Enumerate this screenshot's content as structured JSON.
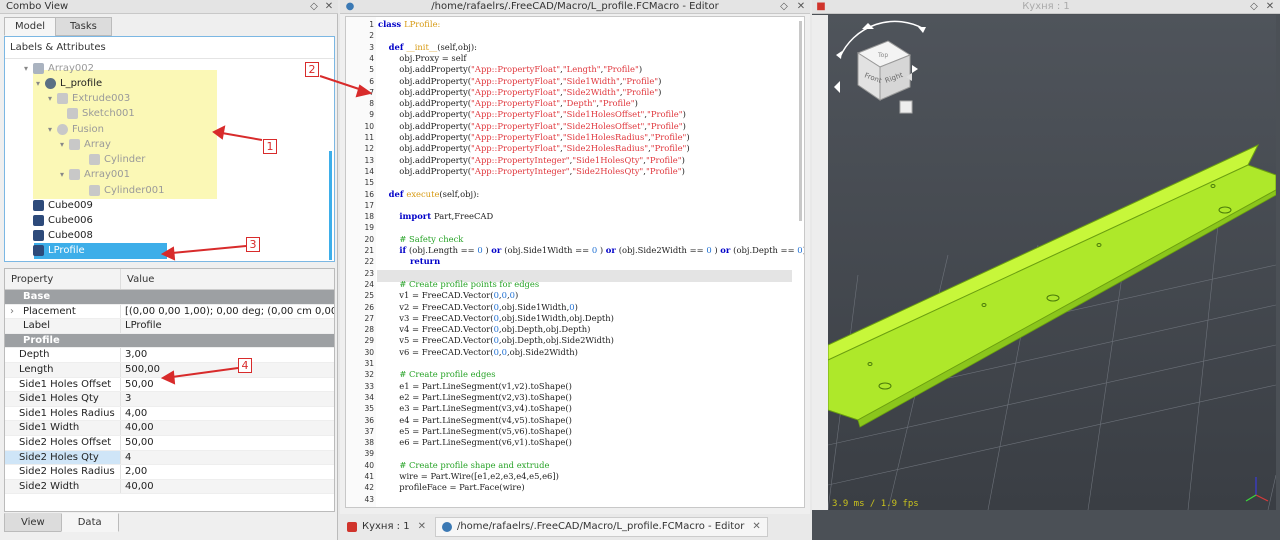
{
  "combo": {
    "title": "Combo View",
    "tabs": [
      "Model",
      "Tasks"
    ],
    "tree_header": "Labels & Attributes",
    "tree": [
      {
        "label": "Array002",
        "dim": true
      },
      {
        "label": "L_profile",
        "dim": false
      },
      {
        "label": "Extrude003",
        "dim": true
      },
      {
        "label": "Sketch001",
        "dim": true
      },
      {
        "label": "Fusion",
        "dim": true
      },
      {
        "label": "Array",
        "dim": true
      },
      {
        "label": "Cylinder",
        "dim": true
      },
      {
        "label": "Array001",
        "dim": true
      },
      {
        "label": "Cylinder001",
        "dim": true
      },
      {
        "label": "Cube009",
        "dim": false
      },
      {
        "label": "Cube006",
        "dim": false
      },
      {
        "label": "Cube008",
        "dim": false
      },
      {
        "label": "LProfile",
        "dim": false
      }
    ],
    "property_header": {
      "name": "Property",
      "value": "Value"
    },
    "base_group": "Base",
    "placement": {
      "name": "Placement",
      "value": "[(0,00 0,00 1,00); 0,00 deg; (0,00 cm  0,00 ..."
    },
    "label_prop": {
      "name": "Label",
      "value": "LProfile"
    },
    "profile_group": "Profile",
    "props": [
      {
        "name": "Depth",
        "value": "3,00"
      },
      {
        "name": "Length",
        "value": "500,00"
      },
      {
        "name": "Side1 Holes Offset",
        "value": "50,00"
      },
      {
        "name": "Side1 Holes Qty",
        "value": "3"
      },
      {
        "name": "Side1 Holes Radius",
        "value": "4,00"
      },
      {
        "name": "Side1 Width",
        "value": "40,00"
      },
      {
        "name": "Side2 Holes Offset",
        "value": "50,00"
      },
      {
        "name": "Side2 Holes Qty",
        "value": "4"
      },
      {
        "name": "Side2 Holes Radius",
        "value": "2,00"
      },
      {
        "name": "Side2 Width",
        "value": "40,00"
      }
    ],
    "bottom_tabs": [
      "View",
      "Data"
    ]
  },
  "editor": {
    "title": "/home/rafaelrs/.FreeCAD/Macro/L_profile.FCMacro - Editor",
    "lines": [
      {
        "n": "1",
        "parts": [
          [
            "kw",
            "class "
          ],
          [
            "cls",
            "LProfile:"
          ]
        ]
      },
      {
        "n": "2",
        "parts": []
      },
      {
        "n": "3",
        "parts": [
          [
            "",
            "    "
          ],
          [
            "kw",
            "def "
          ],
          [
            "cls",
            "__init__"
          ],
          [
            "",
            "(self,obj):"
          ]
        ]
      },
      {
        "n": "4",
        "parts": [
          [
            "",
            "        obj.Proxy = self"
          ]
        ]
      },
      {
        "n": "5",
        "parts": [
          [
            "",
            "        obj.addProperty("
          ],
          [
            "str",
            "\"App::PropertyFloat\""
          ],
          [
            "",
            ","
          ],
          [
            "str",
            "\"Length\""
          ],
          [
            "",
            ","
          ],
          [
            "str",
            "\"Profile\""
          ],
          [
            "",
            ")"
          ]
        ]
      },
      {
        "n": "6",
        "parts": [
          [
            "",
            "        obj.addProperty("
          ],
          [
            "str",
            "\"App::PropertyFloat\""
          ],
          [
            "",
            ","
          ],
          [
            "str",
            "\"Side1Width\""
          ],
          [
            "",
            ","
          ],
          [
            "str",
            "\"Profile\""
          ],
          [
            "",
            ")"
          ]
        ]
      },
      {
        "n": "7",
        "parts": [
          [
            "",
            "        obj.addProperty("
          ],
          [
            "str",
            "\"App::PropertyFloat\""
          ],
          [
            "",
            ","
          ],
          [
            "str",
            "\"Side2Width\""
          ],
          [
            "",
            ","
          ],
          [
            "str",
            "\"Profile\""
          ],
          [
            "",
            ")"
          ]
        ]
      },
      {
        "n": "8",
        "parts": [
          [
            "",
            "        obj.addProperty("
          ],
          [
            "str",
            "\"App::PropertyFloat\""
          ],
          [
            "",
            ","
          ],
          [
            "str",
            "\"Depth\""
          ],
          [
            "",
            ","
          ],
          [
            "str",
            "\"Profile\""
          ],
          [
            "",
            ")"
          ]
        ]
      },
      {
        "n": "9",
        "parts": [
          [
            "",
            "        obj.addProperty("
          ],
          [
            "str",
            "\"App::PropertyFloat\""
          ],
          [
            "",
            ","
          ],
          [
            "str",
            "\"Side1HolesOffset\""
          ],
          [
            "",
            ","
          ],
          [
            "str",
            "\"Profile\""
          ],
          [
            "",
            ")"
          ]
        ]
      },
      {
        "n": "10",
        "parts": [
          [
            "",
            "        obj.addProperty("
          ],
          [
            "str",
            "\"App::PropertyFloat\""
          ],
          [
            "",
            ","
          ],
          [
            "str",
            "\"Side2HolesOffset\""
          ],
          [
            "",
            ","
          ],
          [
            "str",
            "\"Profile\""
          ],
          [
            "",
            ")"
          ]
        ]
      },
      {
        "n": "11",
        "parts": [
          [
            "",
            "        obj.addProperty("
          ],
          [
            "str",
            "\"App::PropertyFloat\""
          ],
          [
            "",
            ","
          ],
          [
            "str",
            "\"Side1HolesRadius\""
          ],
          [
            "",
            ","
          ],
          [
            "str",
            "\"Profile\""
          ],
          [
            "",
            ")"
          ]
        ]
      },
      {
        "n": "12",
        "parts": [
          [
            "",
            "        obj.addProperty("
          ],
          [
            "str",
            "\"App::PropertyFloat\""
          ],
          [
            "",
            ","
          ],
          [
            "str",
            "\"Side2HolesRadius\""
          ],
          [
            "",
            ","
          ],
          [
            "str",
            "\"Profile\""
          ],
          [
            "",
            ")"
          ]
        ]
      },
      {
        "n": "13",
        "parts": [
          [
            "",
            "        obj.addProperty("
          ],
          [
            "str",
            "\"App::PropertyInteger\""
          ],
          [
            "",
            ","
          ],
          [
            "str",
            "\"Side1HolesQty\""
          ],
          [
            "",
            ","
          ],
          [
            "str",
            "\"Profile\""
          ],
          [
            "",
            ")"
          ]
        ]
      },
      {
        "n": "14",
        "parts": [
          [
            "",
            "        obj.addProperty("
          ],
          [
            "str",
            "\"App::PropertyInteger\""
          ],
          [
            "",
            ","
          ],
          [
            "str",
            "\"Side2HolesQty\""
          ],
          [
            "",
            ","
          ],
          [
            "str",
            "\"Profile\""
          ],
          [
            "",
            ")"
          ]
        ]
      },
      {
        "n": "15",
        "parts": []
      },
      {
        "n": "16",
        "parts": [
          [
            "",
            "    "
          ],
          [
            "kw",
            "def "
          ],
          [
            "cls",
            "execute"
          ],
          [
            "",
            "(self,obj):"
          ]
        ]
      },
      {
        "n": "17",
        "parts": []
      },
      {
        "n": "18",
        "parts": [
          [
            "",
            "        "
          ],
          [
            "kw",
            "import "
          ],
          [
            "",
            "Part,FreeCAD"
          ]
        ]
      },
      {
        "n": "19",
        "parts": []
      },
      {
        "n": "20",
        "parts": [
          [
            "",
            "        "
          ],
          [
            "cmt",
            "# Safety check"
          ]
        ]
      },
      {
        "n": "21",
        "parts": [
          [
            "",
            "        "
          ],
          [
            "kw",
            "if "
          ],
          [
            "",
            "(obj.Length == "
          ],
          [
            "num",
            "0"
          ],
          [
            "",
            " ) "
          ],
          [
            "kw",
            "or "
          ],
          [
            "",
            "(obj.Side1Width == "
          ],
          [
            "num",
            "0"
          ],
          [
            "",
            " ) "
          ],
          [
            "kw",
            "or "
          ],
          [
            "",
            "(obj.Side2Width == "
          ],
          [
            "num",
            "0"
          ],
          [
            "",
            " ) "
          ],
          [
            "kw",
            "or "
          ],
          [
            "",
            "(obj.Depth == "
          ],
          [
            "num",
            "0"
          ],
          [
            "",
            ")"
          ]
        ]
      },
      {
        "n": "22",
        "parts": [
          [
            "",
            "            "
          ],
          [
            "kw",
            "return"
          ]
        ]
      },
      {
        "n": "23",
        "parts": []
      },
      {
        "n": "24",
        "parts": [
          [
            "",
            "        "
          ],
          [
            "cmt",
            "# Create profile points for edges"
          ]
        ]
      },
      {
        "n": "25",
        "parts": [
          [
            "",
            "        v1 = FreeCAD.Vector("
          ],
          [
            "num",
            "0"
          ],
          [
            "",
            ","
          ],
          [
            "num",
            "0"
          ],
          [
            "",
            ","
          ],
          [
            "num",
            "0"
          ],
          [
            "",
            ")"
          ]
        ]
      },
      {
        "n": "26",
        "parts": [
          [
            "",
            "        v2 = FreeCAD.Vector("
          ],
          [
            "num",
            "0"
          ],
          [
            "",
            ",obj.Side1Width,"
          ],
          [
            "num",
            "0"
          ],
          [
            "",
            ")"
          ]
        ]
      },
      {
        "n": "27",
        "parts": [
          [
            "",
            "        v3 = FreeCAD.Vector("
          ],
          [
            "num",
            "0"
          ],
          [
            "",
            ",obj.Side1Width,obj.Depth)"
          ]
        ]
      },
      {
        "n": "28",
        "parts": [
          [
            "",
            "        v4 = FreeCAD.Vector("
          ],
          [
            "num",
            "0"
          ],
          [
            "",
            ",obj.Depth,obj.Depth)"
          ]
        ]
      },
      {
        "n": "29",
        "parts": [
          [
            "",
            "        v5 = FreeCAD.Vector("
          ],
          [
            "num",
            "0"
          ],
          [
            "",
            ",obj.Depth,obj.Side2Width)"
          ]
        ]
      },
      {
        "n": "30",
        "parts": [
          [
            "",
            "        v6 = FreeCAD.Vector("
          ],
          [
            "num",
            "0"
          ],
          [
            "",
            ","
          ],
          [
            "num",
            "0"
          ],
          [
            "",
            ",obj.Side2Width)"
          ]
        ]
      },
      {
        "n": "31",
        "parts": []
      },
      {
        "n": "32",
        "parts": [
          [
            "",
            "        "
          ],
          [
            "cmt",
            "# Create profile edges"
          ]
        ]
      },
      {
        "n": "33",
        "parts": [
          [
            "",
            "        e1 = Part.LineSegment(v1,v2).toShape()"
          ]
        ]
      },
      {
        "n": "34",
        "parts": [
          [
            "",
            "        e2 = Part.LineSegment(v2,v3).toShape()"
          ]
        ]
      },
      {
        "n": "35",
        "parts": [
          [
            "",
            "        e3 = Part.LineSegment(v3,v4).toShape()"
          ]
        ]
      },
      {
        "n": "36",
        "parts": [
          [
            "",
            "        e4 = Part.LineSegment(v4,v5).toShape()"
          ]
        ]
      },
      {
        "n": "37",
        "parts": [
          [
            "",
            "        e5 = Part.LineSegment(v5,v6).toShape()"
          ]
        ]
      },
      {
        "n": "38",
        "parts": [
          [
            "",
            "        e6 = Part.LineSegment(v6,v1).toShape()"
          ]
        ]
      },
      {
        "n": "39",
        "parts": []
      },
      {
        "n": "40",
        "parts": [
          [
            "",
            "        "
          ],
          [
            "cmt",
            "# Create profile shape and extrude"
          ]
        ]
      },
      {
        "n": "41",
        "parts": [
          [
            "",
            "        wire = Part.Wire([e1,e2,e3,e4,e5,e6])"
          ]
        ]
      },
      {
        "n": "42",
        "parts": [
          [
            "",
            "        profileFace = Part.Face(wire)"
          ]
        ]
      },
      {
        "n": "43",
        "parts": []
      }
    ]
  },
  "taskbar": [
    {
      "label": "Кухня : 1",
      "active": false
    },
    {
      "label": "/home/rafaelrs/.FreeCAD/Macro/L_profile.FCMacro - Editor",
      "active": true
    }
  ],
  "view3d": {
    "title": "Кухня : 1",
    "fps": "3.9 ms / 1.9 fps",
    "cube_front": "Front",
    "cube_right": "Right",
    "cube_top": "Top",
    "part_color": "#b7f01f"
  },
  "callouts": [
    "1",
    "2",
    "3",
    "4"
  ],
  "accent": "#3daee9",
  "annotation_color": "#d82b2b"
}
